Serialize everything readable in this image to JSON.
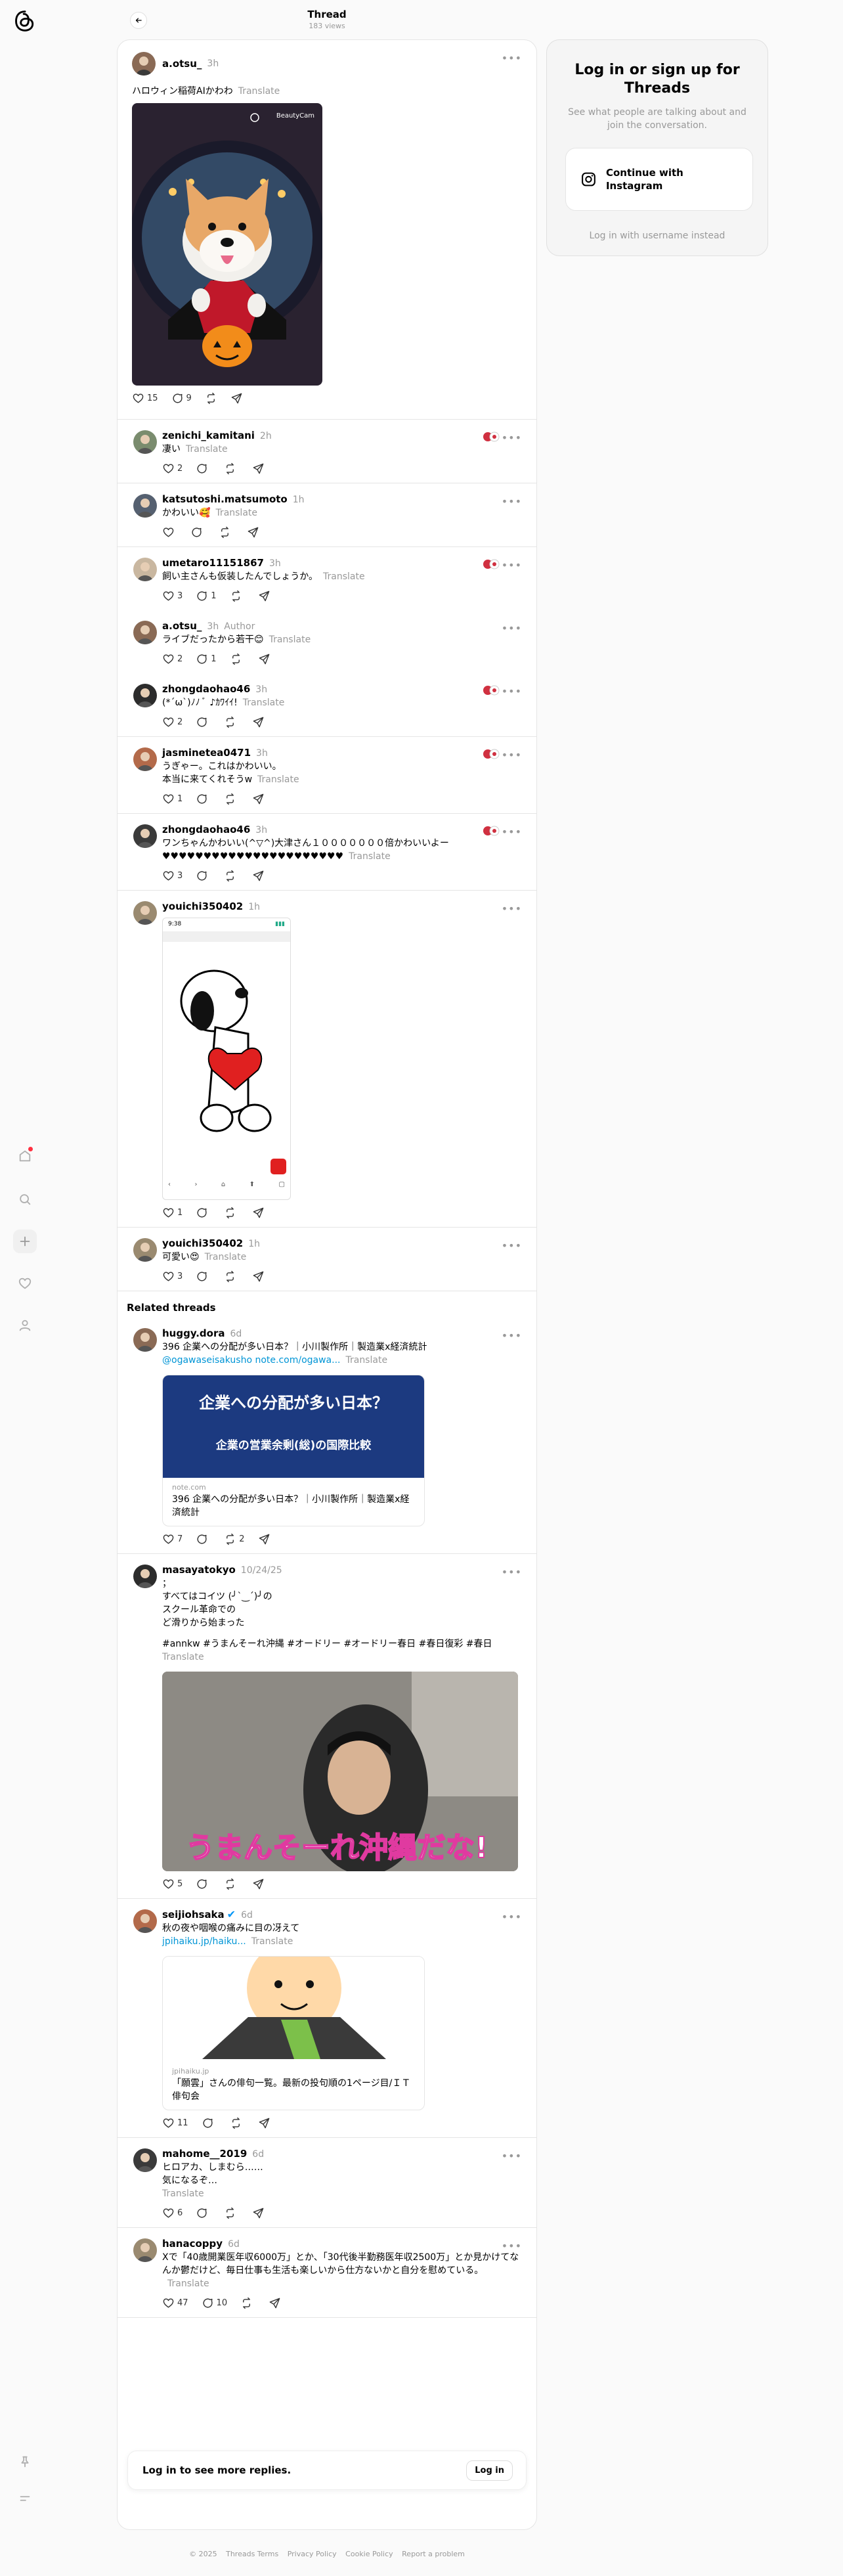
{
  "header": {
    "title": "Thread",
    "views": "183 views"
  },
  "main_post": {
    "user": "a.otsu_",
    "time": "3h",
    "text": "ハロウィン稲荷AIかわわ",
    "translate": "Translate",
    "image_watermark": "BeautyCam",
    "likes": "15",
    "comments": "9"
  },
  "replies": [
    {
      "user": "zenichi_kamitani",
      "time": "2h",
      "text": "凄い",
      "translate": "Translate",
      "likes": "2",
      "comments": "",
      "reposts": ""
    },
    {
      "user": "katsutoshi.matsumoto",
      "time": "1h",
      "text": "かわいい🥰",
      "translate": "Translate",
      "likes": "",
      "comments": "",
      "reposts": ""
    },
    {
      "user": "umetaro11151867",
      "time": "3h",
      "text": "飼い主さんも仮装したんでしょうか。",
      "translate": "Translate",
      "likes": "3",
      "comments": "1",
      "reposts": ""
    },
    {
      "user": "a.otsu_",
      "time": "3h",
      "author": "Author",
      "text": "ライブだったから若干😊",
      "translate": "Translate",
      "likes": "2",
      "comments": "1",
      "reposts": ""
    },
    {
      "user": "zhongdaohao46",
      "time": "3h",
      "text": "(*´ω`)ﾉﾉ ﾞ ♪ｶﾜｲｲ!",
      "translate": "Translate",
      "likes": "2",
      "comments": "",
      "reposts": ""
    },
    {
      "user": "jasminetea0471",
      "time": "3h",
      "text": "うぎゃー。これはかわいい。",
      "text2": "本当に来てくれそうw",
      "translate": "Translate",
      "likes": "1",
      "comments": "",
      "reposts": ""
    },
    {
      "user": "zhongdaohao46",
      "time": "3h",
      "text": "ワンちゃんかわいい(^▽^)大津さん１０００００００倍かわいいよー",
      "text2": "♥♥♥♥♥♥♥♥♥♥♥♥♥♥♥♥♥♥♥♥♥♥",
      "translate": "Translate",
      "likes": "3",
      "comments": "",
      "reposts": ""
    },
    {
      "user": "youichi350402",
      "time": "1h",
      "text": "",
      "translate": "",
      "likes": "1",
      "comments": "",
      "reposts": "",
      "phone_time": "9:38"
    },
    {
      "user": "youichi350402",
      "time": "1h",
      "text": "可愛い😍",
      "translate": "Translate",
      "likes": "3",
      "comments": "",
      "reposts": ""
    }
  ],
  "related_title": "Related threads",
  "related": [
    {
      "user": "huggy.dora",
      "time": "6d",
      "text": "396 企業への分配が多い日本？｜小川製作所｜製造業x経済統計",
      "link": "@ogawaseisakusho note.com/ogawa...",
      "translate": "Translate",
      "card_domain": "note.com",
      "card_title": "396 企業への分配が多い日本？｜小川製作所｜製造業x経済統計",
      "card_img_line1": "企業への分配が多い日本？",
      "card_img_line2": "企業の営業余剰(総)の国際比較",
      "likes": "7",
      "reposts": "2"
    },
    {
      "user": "masayatokyo",
      "time": "10/24/25",
      "lines": [
        "；",
        "すべてはコイツ (╯`‿´)╯の",
        "スクール革命での",
        "ど滑りから始まった"
      ],
      "hashtags": "#annkw #うまんそーれ沖縄 #オードリー #オードリー春日 #春日復彩 #春日",
      "translate": "Translate",
      "video_caption": "うまんそーれ沖縄だな!",
      "likes": "5"
    },
    {
      "user": "seijiohsaka",
      "time": "6d",
      "text": "秋の夜や咽喉の痛みに目の冴えて",
      "link": "jpihaiku.jp/haiku...",
      "translate": "Translate",
      "card_domain": "jpihaiku.jp",
      "card_title": "「願雲」さんの俳句一覧。最新の投句順の1ページ目/ＩＴ俳句会",
      "likes": "11"
    },
    {
      "user": "mahome__2019",
      "time": "6d",
      "lines": [
        "ヒロアカ、しまむら……",
        "気になるぞ…"
      ],
      "translate": "Translate",
      "likes": "6"
    },
    {
      "user": "hanacoppy",
      "time": "6d",
      "text": "Xで「40歳開業医年収6000万」とか、「30代後半勤務医年収2500万」とか見かけてなんか鬱だけど、毎日仕事も生活も楽しいから仕方ないかと自分を慰めている。",
      "translate": "Translate",
      "likes": "47",
      "comments": "10"
    }
  ],
  "login_bar": {
    "text": "Log in to see more replies.",
    "button": "Log in"
  },
  "right_panel": {
    "title": "Log in or sign up for Threads",
    "subtitle": "See what people are talking about and join the conversation.",
    "ig_button": "Continue with Instagram",
    "alt_link": "Log in with username instead"
  },
  "footer": [
    "© 2025",
    "Threads Terms",
    "Privacy Policy",
    "Cookie Policy",
    "Report a problem"
  ],
  "colors": {
    "accent": "#0095d6",
    "notif_dot": "#ff3040",
    "verified": "#0095f6"
  }
}
